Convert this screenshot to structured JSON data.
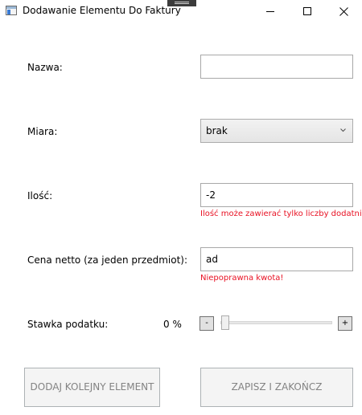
{
  "window": {
    "title": "Dodawanie Elementu Do Faktury",
    "controls": {
      "minimize_icon": "minimize-icon",
      "maximize_icon": "maximize-icon",
      "close_icon": "close-icon"
    }
  },
  "form": {
    "name": {
      "label": "Nazwa:",
      "value": ""
    },
    "measure": {
      "label": "Miara:",
      "selected": "brak"
    },
    "quantity": {
      "label": "Ilość:",
      "value": "-2",
      "error": "Ilość może zawierać tylko liczby dodatnie!"
    },
    "price": {
      "label": "Cena netto (za jeden przedmiot):",
      "value": "ad",
      "error": "Niepoprawna kwota!"
    },
    "tax": {
      "label": "Stawka podatku:",
      "value_display": "0 %",
      "value": 0,
      "decrement_label": "-",
      "increment_label": "+"
    }
  },
  "buttons": {
    "add_another": "DODAJ KOLEJNY ELEMENT",
    "save_close": "ZAPISZ I ZAKOŃCZ"
  },
  "colors": {
    "error": "#e81123",
    "disabled_text": "#838383"
  }
}
